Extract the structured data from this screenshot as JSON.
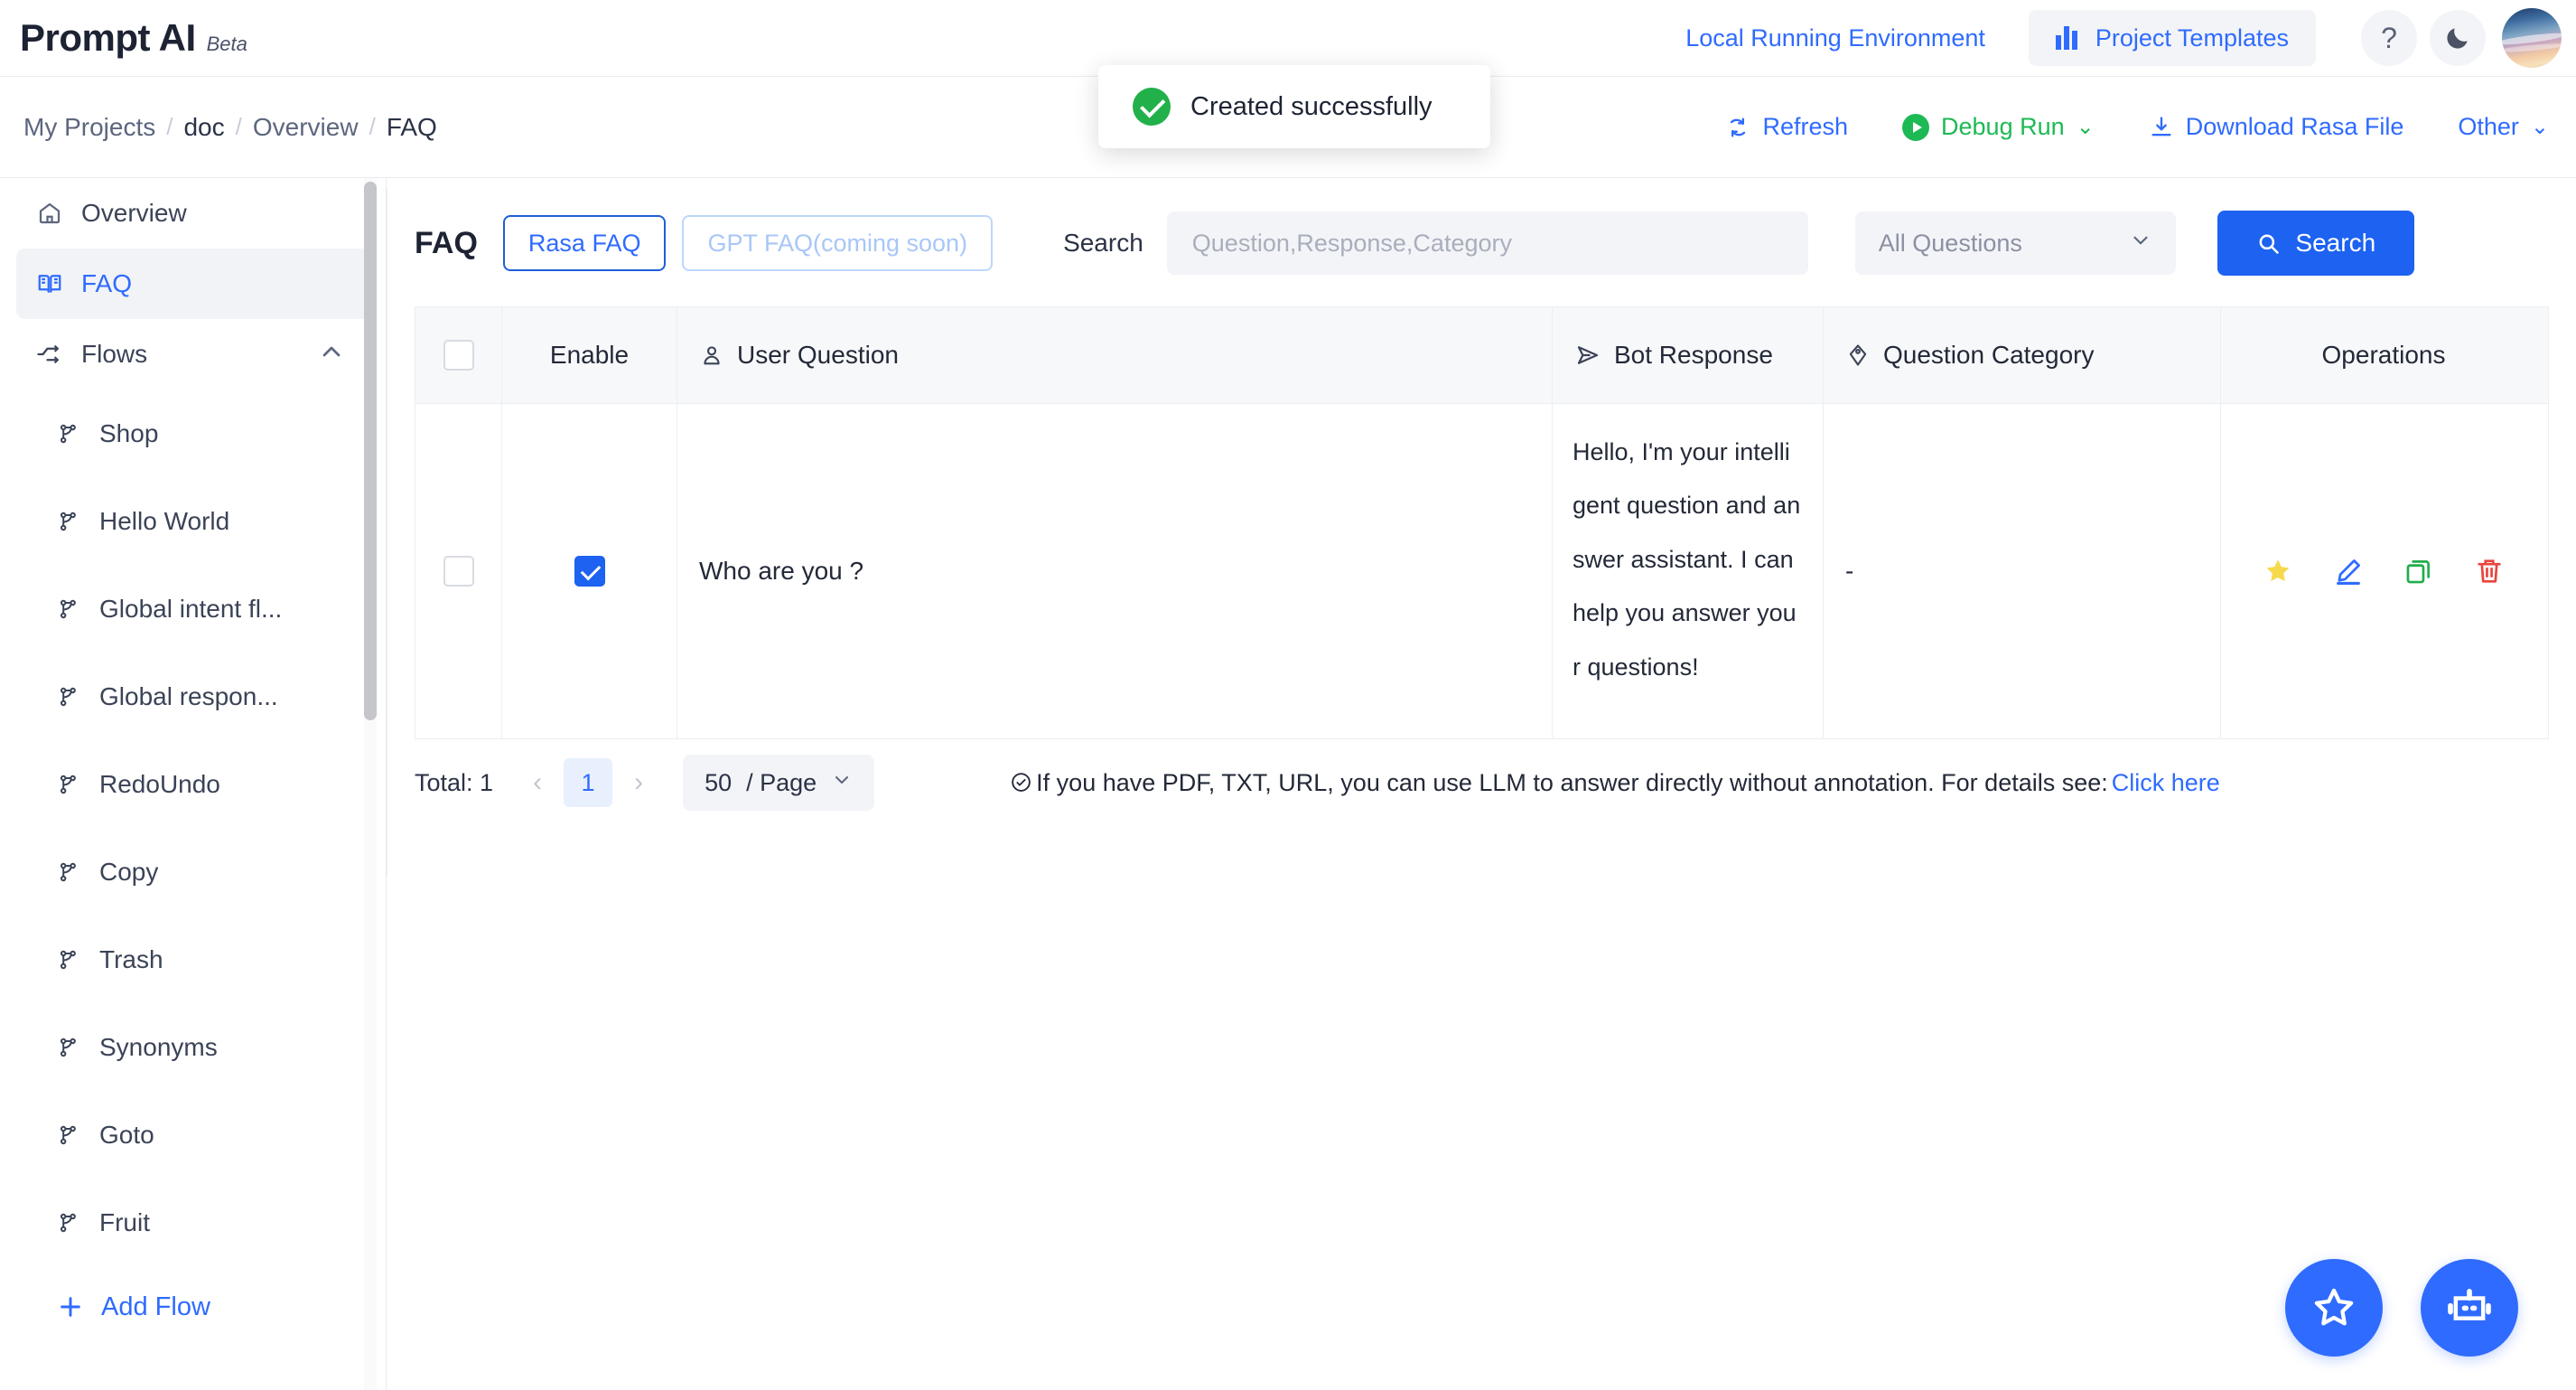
{
  "header": {
    "brand": "Prompt AI",
    "brand_tag": "Beta",
    "env_link": "Local Running Environment",
    "templates_label": "Project Templates",
    "help_icon": "?",
    "theme_icon": "moon-icon"
  },
  "breadcrumb": {
    "items": [
      "My Projects",
      "doc",
      "Overview",
      "FAQ"
    ],
    "separator": "/"
  },
  "toolbar": {
    "refresh": "Refresh",
    "debug_run": "Debug Run",
    "download": "Download Rasa File",
    "other": "Other",
    "caret": "⌄"
  },
  "toast": {
    "message": "Created successfully",
    "icon": "success-check-icon"
  },
  "sidebar": {
    "overview": "Overview",
    "faq": "FAQ",
    "flows_group": "Flows",
    "flows": [
      "Shop",
      "Hello World",
      "Global intent fl...",
      "Global respon...",
      "RedoUndo",
      "Copy",
      "Trash",
      "Synonyms",
      "Goto",
      "Fruit"
    ],
    "add_flow": "Add Flow"
  },
  "panel": {
    "title": "FAQ",
    "tab_active": "Rasa FAQ",
    "tab_disabled": "GPT FAQ(coming soon)",
    "search_label": "Search",
    "search_placeholder": "Question,Response,Category",
    "search_value": "",
    "filter_selected": "All Questions",
    "search_button": "Search"
  },
  "table": {
    "columns": [
      "Enable",
      "User Question",
      "Bot Response",
      "Question Category",
      "Operations"
    ],
    "rows": [
      {
        "selected": false,
        "enabled": true,
        "question": "Who are you ?",
        "response": "Hello, I'm your intelligent question and answer assistant. I can help you answer your questions!",
        "category": "-",
        "ops": [
          "star-icon",
          "edit-icon",
          "copy-icon",
          "delete-icon"
        ]
      }
    ]
  },
  "footer": {
    "total": "Total: 1",
    "prev": "‹",
    "page": "1",
    "next": "›",
    "page_size": "50",
    "page_size_suffix": "/ Page",
    "hint_text": "If you have PDF, TXT, URL, you can use LLM to answer directly without annotation. For details see:",
    "hint_link": "Click here"
  },
  "fabs": {
    "star": "star-outline-icon",
    "bot": "robot-icon"
  },
  "colors": {
    "accent": "#2f6bff",
    "primary_button": "#1d62f0",
    "success": "#22b04a",
    "danger": "#e8453c",
    "star": "#f7d94c"
  }
}
